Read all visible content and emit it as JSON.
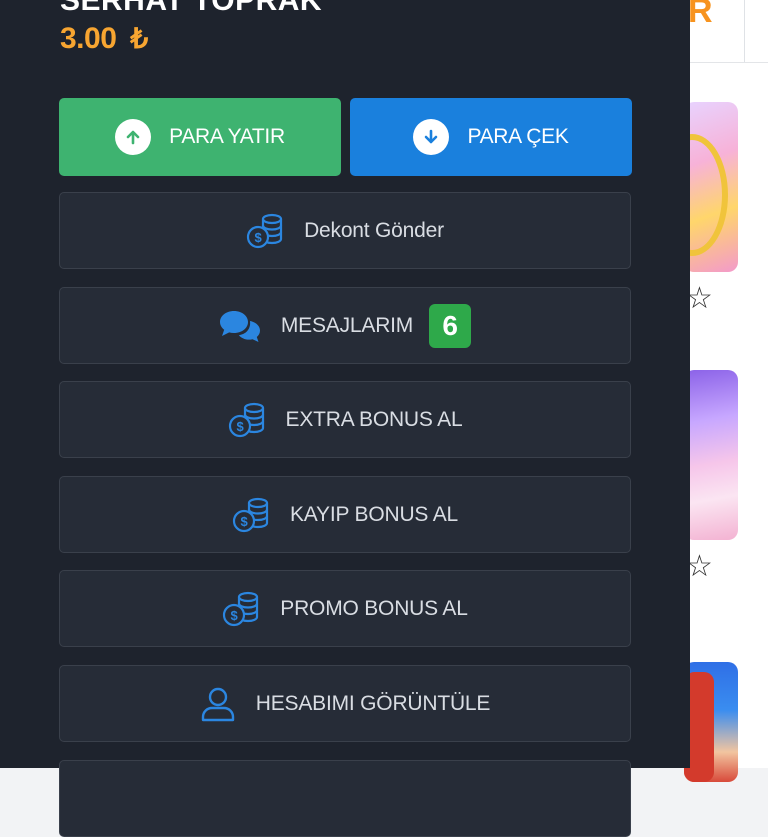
{
  "colors": {
    "drawer_bg": "#1e232d",
    "item_bg": "#262c37",
    "deposit_green": "#3eb370",
    "withdraw_blue": "#1a80dd",
    "balance_orange": "#f7a531",
    "icon_blue": "#2b86e0",
    "badge_green": "#2ea94a"
  },
  "user": {
    "name": "SERHAT TOPRAK",
    "balance": "3.00",
    "currency": "₺"
  },
  "actions": {
    "deposit_label": "PARA YATIR",
    "withdraw_label": "PARA ÇEK"
  },
  "menu": [
    {
      "label": "Dekont Gönder",
      "icon": "coins-icon"
    },
    {
      "label": "MESAJLARIM",
      "icon": "chat-bubbles-icon",
      "badge": "6"
    },
    {
      "label": "EXTRA BONUS AL",
      "icon": "coins-icon"
    },
    {
      "label": "KAYIP BONUS AL",
      "icon": "coins-icon"
    },
    {
      "label": "PROMO BONUS AL",
      "icon": "coins-icon"
    },
    {
      "label": "HESABIMI GÖRÜNTÜLE",
      "icon": "user-icon"
    }
  ],
  "background": {
    "header_fragment": "R"
  }
}
